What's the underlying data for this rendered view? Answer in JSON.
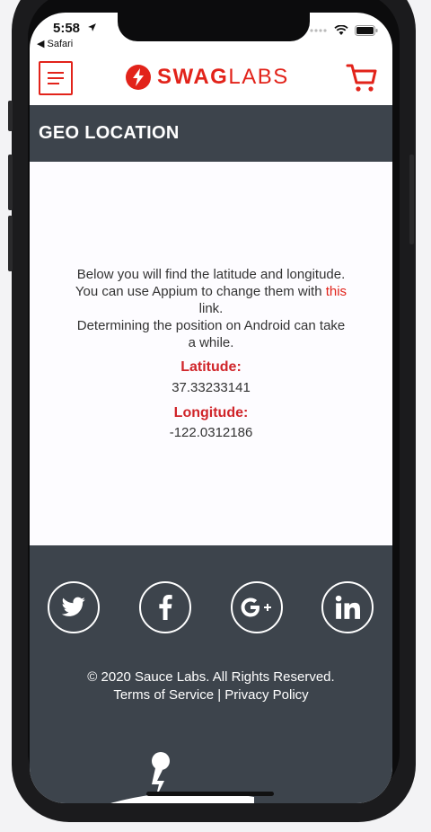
{
  "status_bar": {
    "time": "5:58",
    "back_app": "◀ Safari"
  },
  "header": {
    "logo_bold": "SWAG",
    "logo_light": "LABS"
  },
  "page": {
    "title": "GEO LOCATION"
  },
  "geo": {
    "desc_line1": "Below you will find the latitude and longitude.",
    "desc_line2_prefix": "You can use Appium to change them with ",
    "desc_link": "this",
    "desc_line3": "link.",
    "desc_line4": "Determining the position on Android can take",
    "desc_line5": "a while.",
    "latitude_label": "Latitude:",
    "latitude_value": "37.33233141",
    "longitude_label": "Longitude:",
    "longitude_value": "-122.0312186"
  },
  "footer": {
    "copyright": "© 2020 Sauce Labs. All Rights Reserved.",
    "terms": "Terms of Service",
    "separator": "|",
    "privacy": "Privacy Policy"
  },
  "colors": {
    "brand_red": "#e2231a",
    "dark_bar": "#3d444c"
  }
}
